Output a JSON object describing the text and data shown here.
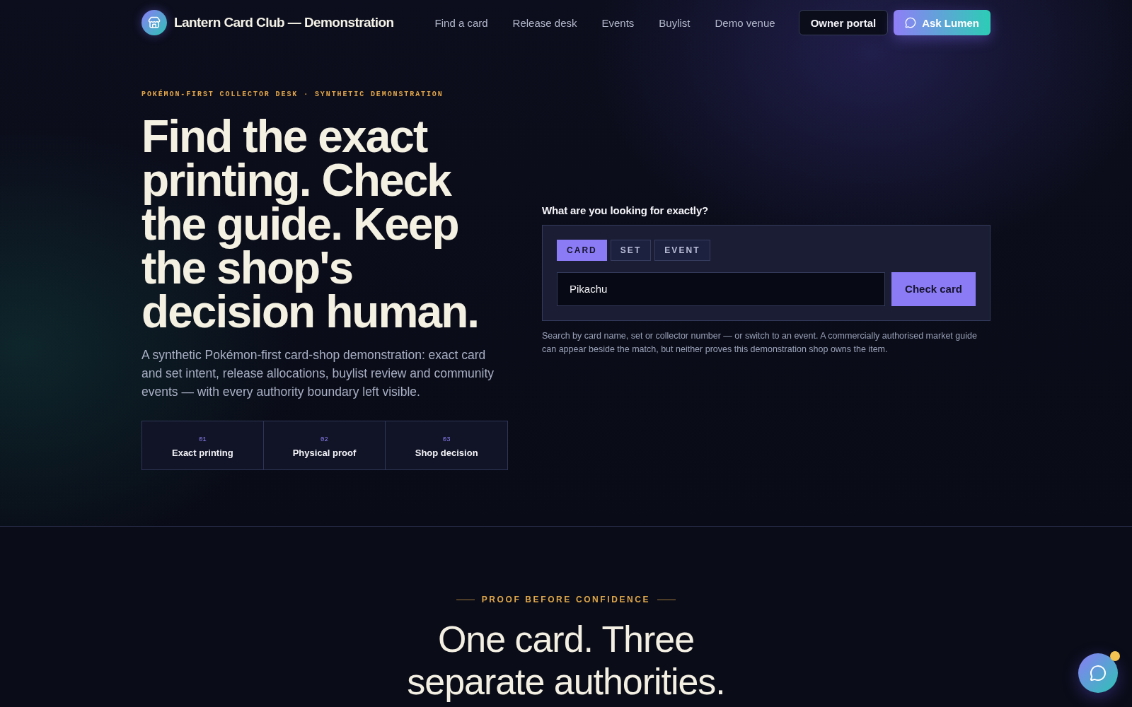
{
  "header": {
    "brand": "Lantern Card Club — Demonstration",
    "nav": [
      {
        "label": "Find a card"
      },
      {
        "label": "Release desk"
      },
      {
        "label": "Events"
      },
      {
        "label": "Buylist"
      },
      {
        "label": "Demo venue"
      }
    ],
    "actions": [
      {
        "label": "Owner portal",
        "kind": "outline"
      },
      {
        "label": "Ask Lumen",
        "kind": "primary"
      }
    ]
  },
  "hero": {
    "kicker": "POKÉMON-FIRST COLLECTOR DESK · SYNTHETIC DEMONSTRATION",
    "title": "Find the exact printing. Check the guide. Keep the shop's decision human.",
    "lede": "A synthetic Pokémon-first card-shop demonstration: exact card and set intent, release allocations, buylist review and community events — with every authority boundary left visible.",
    "steps": [
      {
        "number": "01",
        "label": "Exact printing"
      },
      {
        "number": "02",
        "label": "Physical proof"
      },
      {
        "number": "03",
        "label": "Shop decision"
      }
    ]
  },
  "search": {
    "label": "What are you looking for exactly?",
    "tabs": [
      {
        "label": "CARD",
        "selected": true
      },
      {
        "label": "SET",
        "selected": false
      },
      {
        "label": "EVENT",
        "selected": false
      }
    ],
    "query": {
      "value": "Pikachu"
    },
    "submit": "Check card",
    "help": "Search by card name, set or collector number — or switch to an event. A commercially authorised market guide can appear beside the match, but neither proves this demonstration shop owns the item."
  },
  "proof_section": {
    "eyebrow": "PROOF BEFORE CONFIDENCE",
    "heading": "One card. Three separate authorities."
  },
  "chat_launcher": {
    "unread": true
  }
}
